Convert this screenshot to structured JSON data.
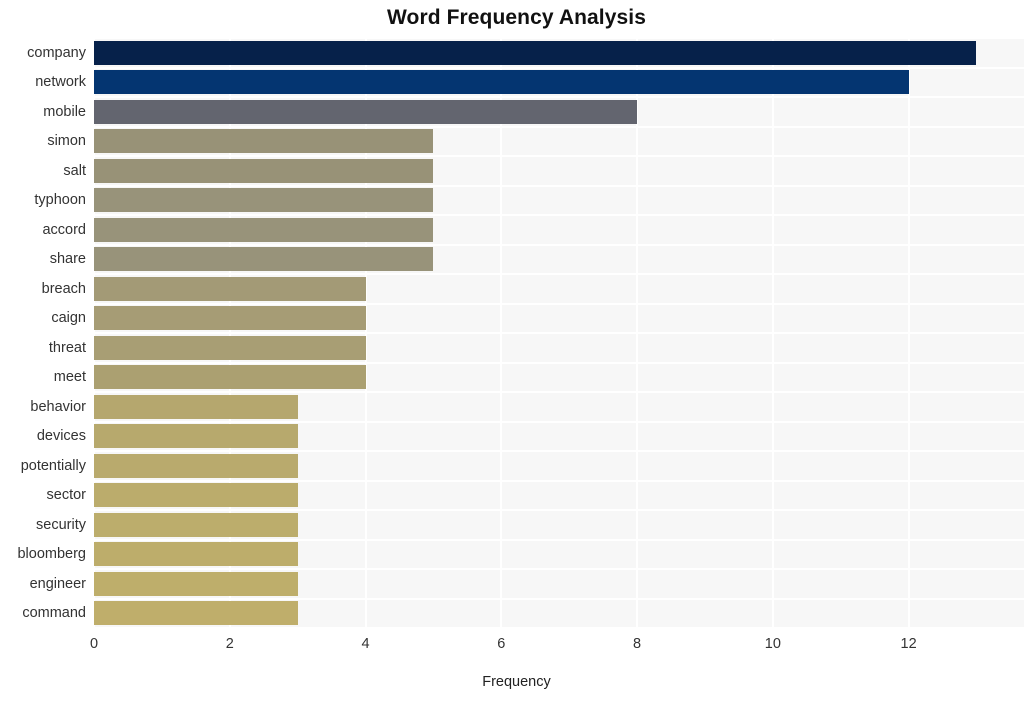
{
  "chart_data": {
    "type": "bar",
    "orientation": "horizontal",
    "title": "Word Frequency Analysis",
    "xlabel": "Frequency",
    "ylabel": "",
    "categories": [
      "company",
      "network",
      "mobile",
      "simon",
      "salt",
      "typhoon",
      "accord",
      "share",
      "breach",
      "caign",
      "threat",
      "meet",
      "behavior",
      "devices",
      "potentially",
      "sector",
      "security",
      "bloomberg",
      "engineer",
      "command"
    ],
    "values": [
      13,
      12,
      8,
      5,
      5,
      5,
      5,
      5,
      4,
      4,
      4,
      4,
      3,
      3,
      3,
      3,
      3,
      3,
      3,
      3
    ],
    "bar_colors": [
      "#06214a",
      "#043571",
      "#63656f",
      "#989277",
      "#989277",
      "#98937a",
      "#98937a",
      "#98937a",
      "#a39a76",
      "#a69c75",
      "#a89e74",
      "#aba071",
      "#b5a76e",
      "#b7a96d",
      "#b9aa6d",
      "#bbac6c",
      "#bcad6c",
      "#bdad6b",
      "#beae6b",
      "#bfae6b"
    ],
    "xticks": [
      0,
      2,
      4,
      6,
      8,
      10,
      12
    ],
    "xlim": [
      0,
      13.7
    ],
    "grid": true,
    "grid_color": "#ffffff",
    "plot_background": "#f7f7f7",
    "figure_background": "#ffffff"
  }
}
